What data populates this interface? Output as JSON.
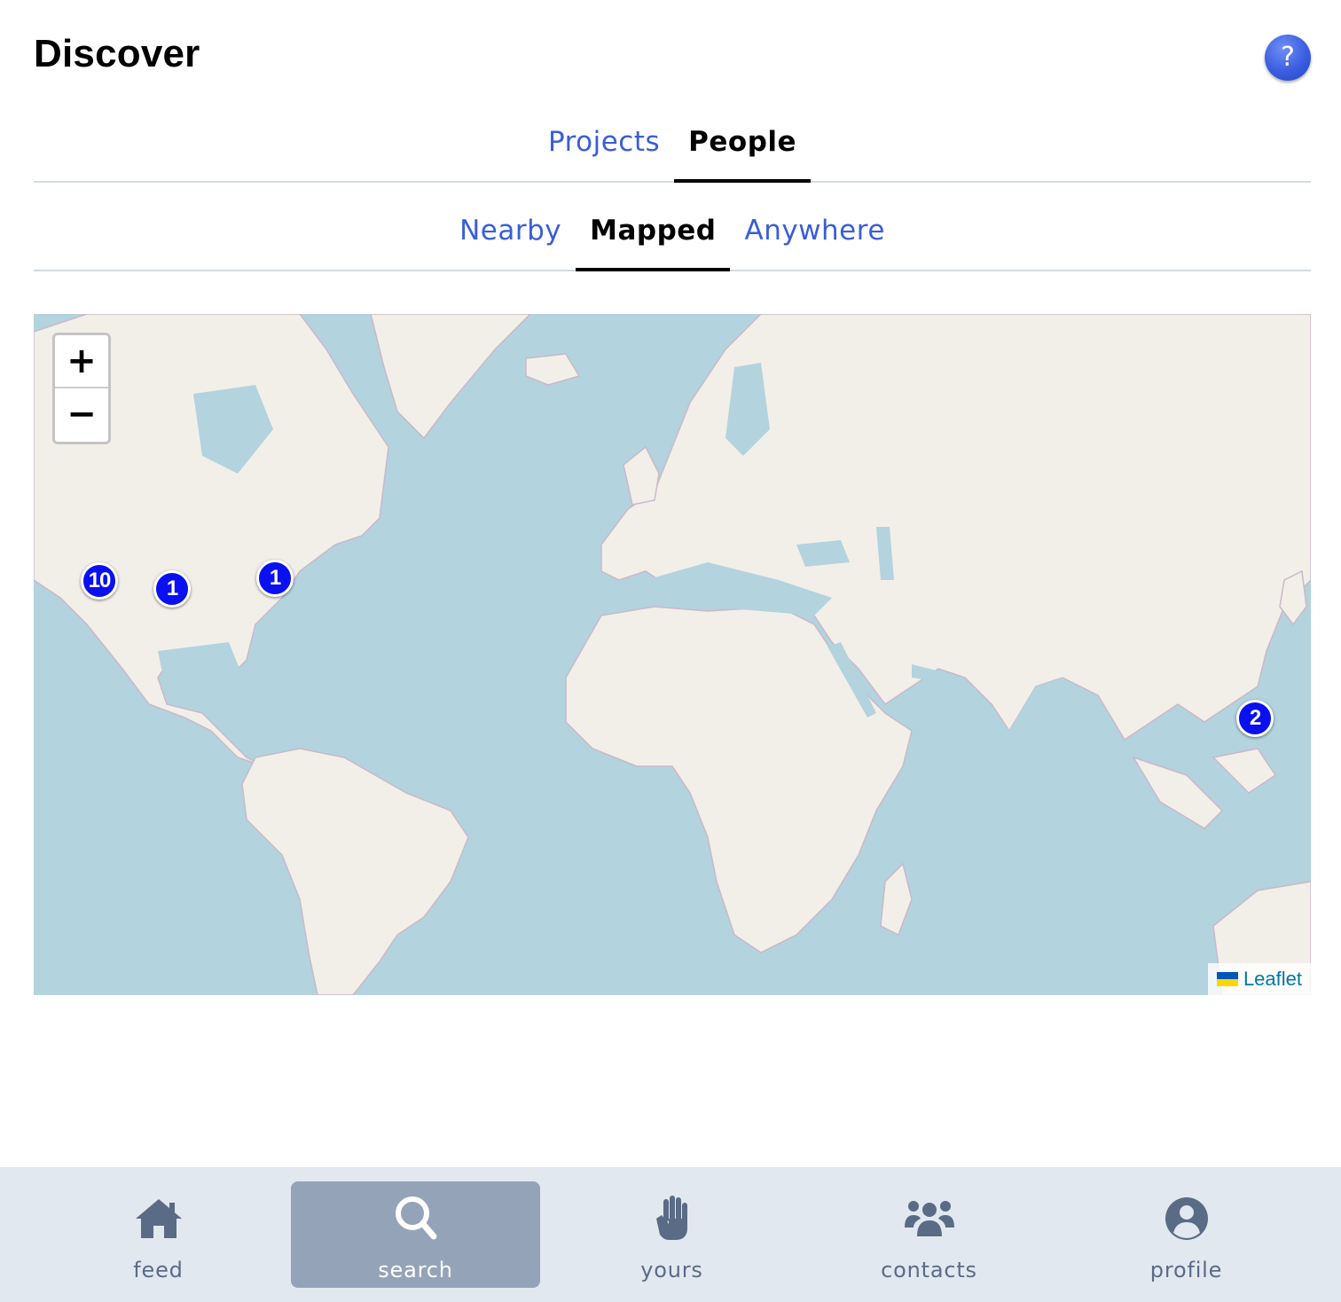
{
  "header": {
    "title": "Discover",
    "help_label": "?"
  },
  "primary_tabs": [
    {
      "label": "Projects",
      "active": false
    },
    {
      "label": "People",
      "active": true
    }
  ],
  "secondary_tabs": [
    {
      "label": "Nearby",
      "active": false
    },
    {
      "label": "Mapped",
      "active": true
    },
    {
      "label": "Anywhere",
      "active": false
    }
  ],
  "map": {
    "zoom_in_label": "+",
    "zoom_out_label": "−",
    "markers": [
      {
        "count": "10",
        "region": "western United States"
      },
      {
        "count": "1",
        "region": "central United States"
      },
      {
        "count": "1",
        "region": "eastern United States"
      },
      {
        "count": "2",
        "region": "Philippines"
      }
    ],
    "attribution": "Leaflet",
    "colors": {
      "water": "#b3d3de",
      "land": "#f2efe9",
      "marker": "#0a10f0"
    }
  },
  "bottom_nav": [
    {
      "label": "feed",
      "icon": "house-icon",
      "active": false
    },
    {
      "label": "search",
      "icon": "magnifier-icon",
      "active": true
    },
    {
      "label": "yours",
      "icon": "hand-icon",
      "active": false
    },
    {
      "label": "contacts",
      "icon": "users-icon",
      "active": false
    },
    {
      "label": "profile",
      "icon": "user-circle-icon",
      "active": false
    }
  ]
}
